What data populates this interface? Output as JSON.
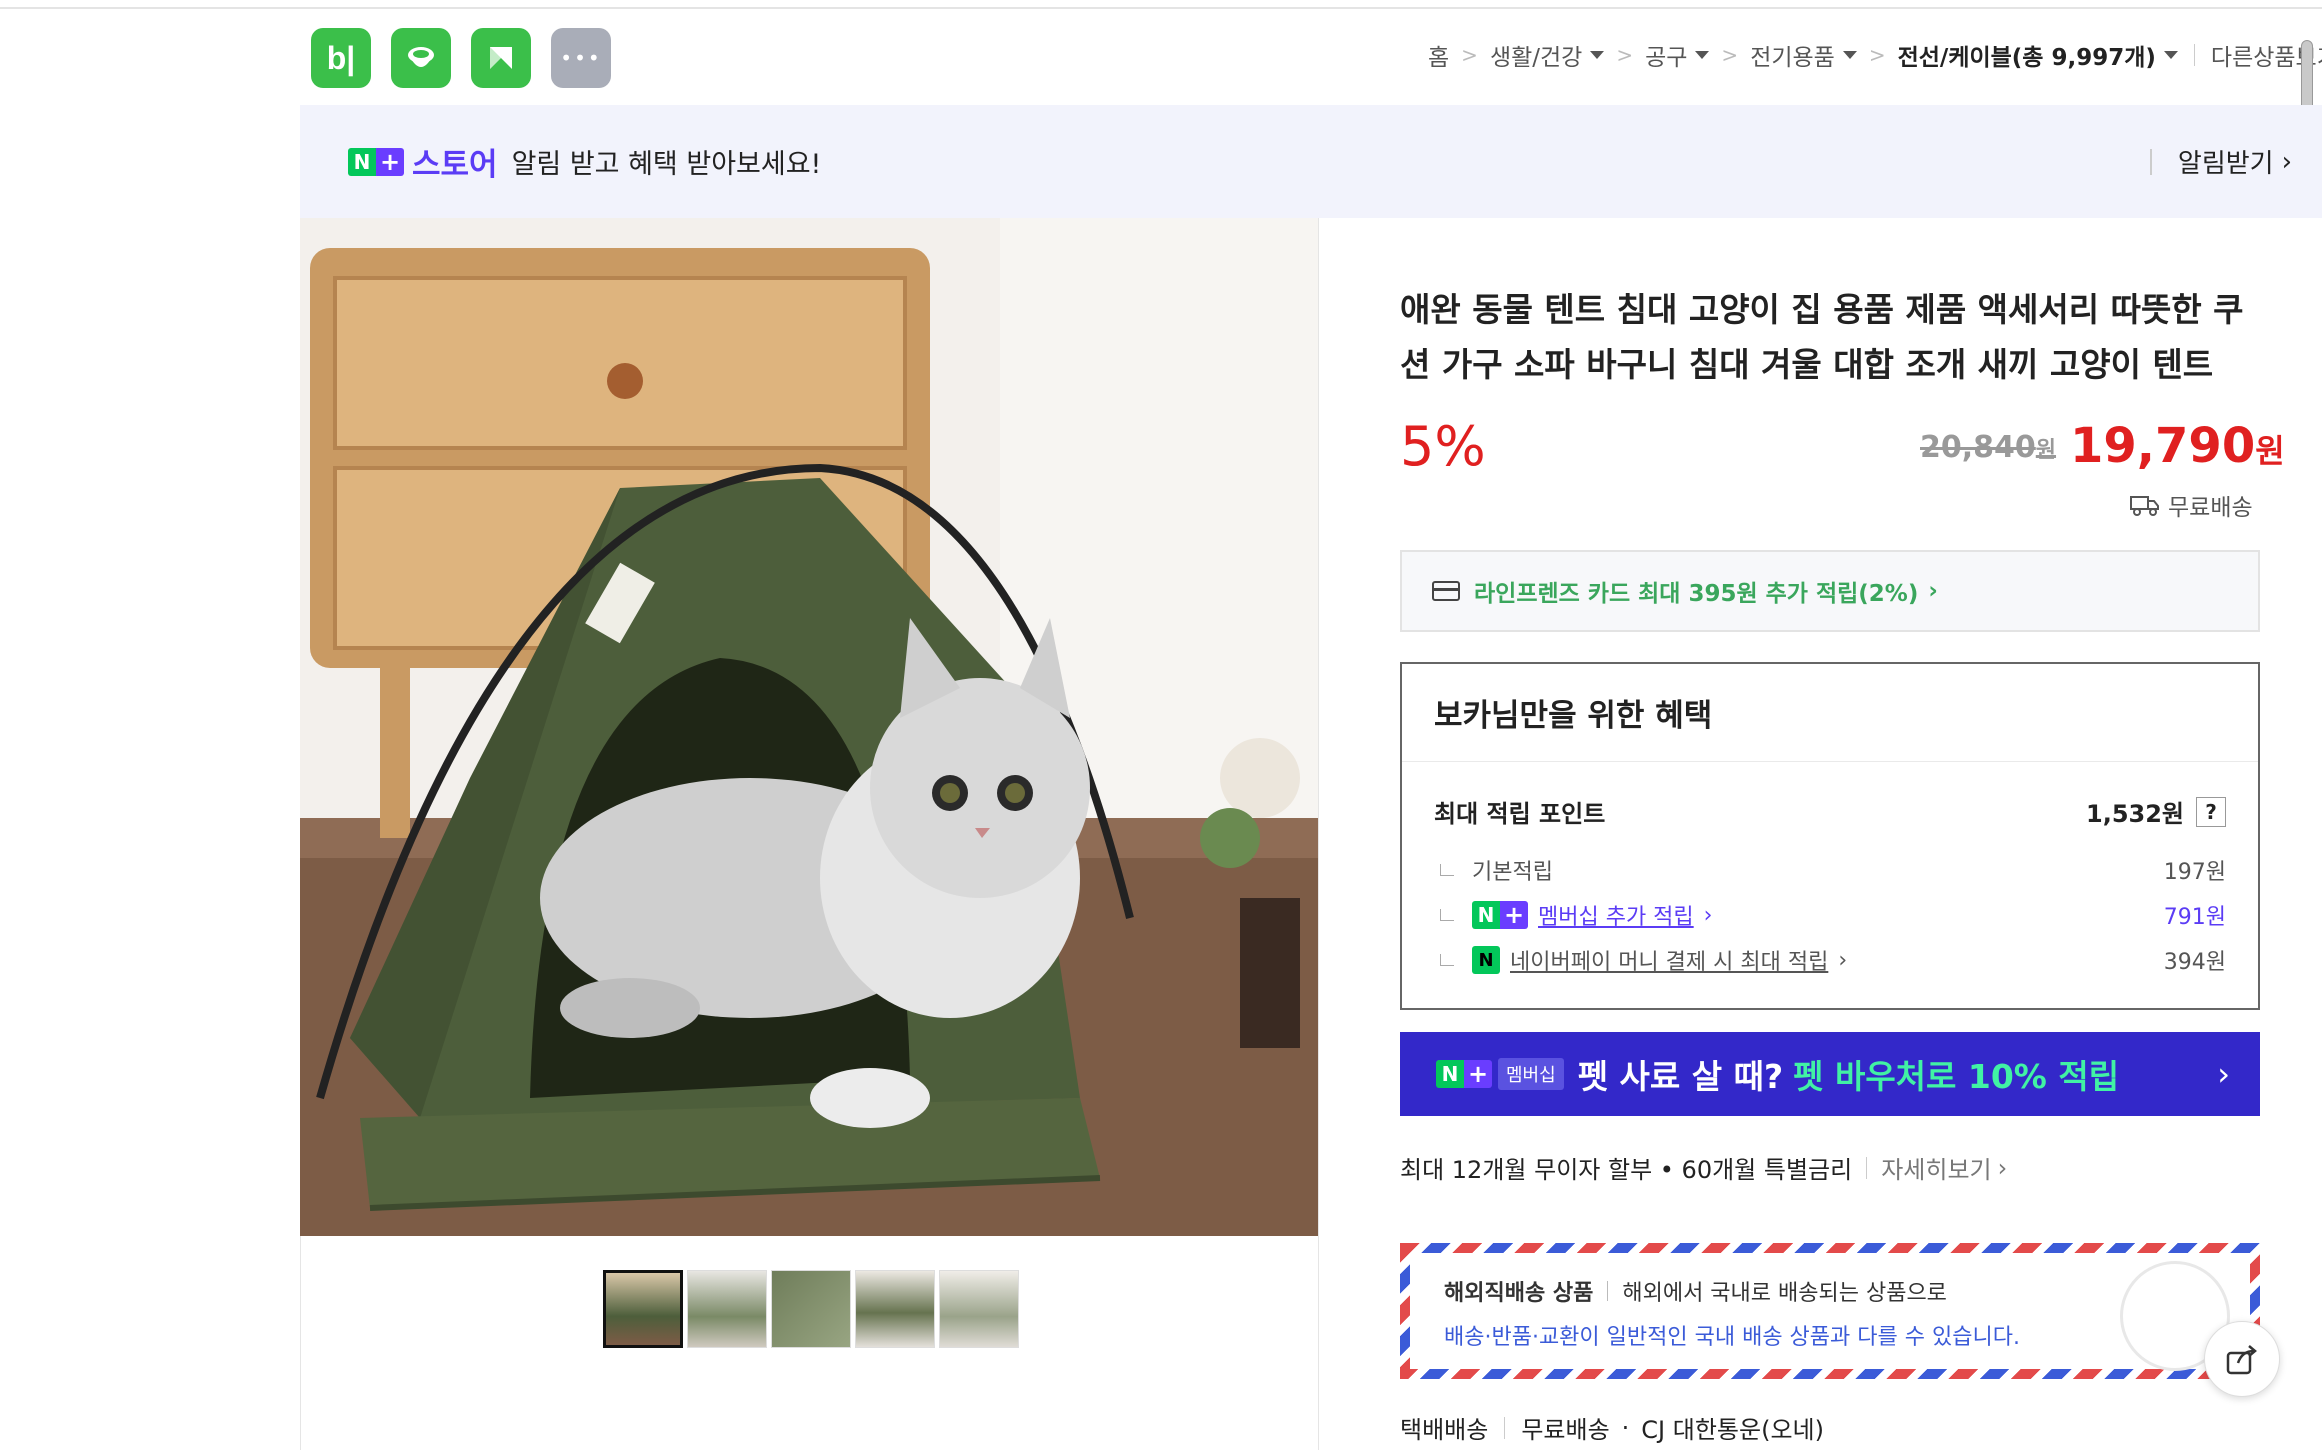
{
  "app_icons": [
    {
      "name": "blog-icon",
      "glyph": "b|"
    },
    {
      "name": "cafe-icon",
      "glyph": ""
    },
    {
      "name": "kakao-icon",
      "glyph": ""
    },
    {
      "name": "more-icon",
      "glyph": "•••"
    }
  ],
  "breadcrumb": {
    "home": "홈",
    "items": [
      "생활/건강",
      "공구",
      "전기용품"
    ],
    "current": "전선/케이블",
    "count": "(총 9,997개)",
    "other": "다른상품보기"
  },
  "banner": {
    "store": "스토어",
    "message": "알림 받고 혜택 받아보세요!",
    "action": "알림받기"
  },
  "product": {
    "title_line1": "애완 동물 텐트 침대 고양이 집 용품 제품 액세서리 따뜻한 쿠",
    "title_line2": "션 가구 소파 바구니 침대 겨울 대합 조개 새끼 고양이 텐트",
    "discount": "5%",
    "original_price": "20,840",
    "original_unit": "원",
    "sale_price": "19,790",
    "sale_unit": "원",
    "shipping": "무료배송"
  },
  "card_offer": "라인프렌즈 카드 최대 395원 추가 적립(2%)",
  "benefits": {
    "title": "보카님만을 위한 혜택",
    "max_points_label": "최대 적립 포인트",
    "max_points_value": "1,532원",
    "help": "?",
    "basic_label": "기본적립",
    "basic_value": "197원",
    "membership_label": "멤버십 추가 적립",
    "membership_value": "791원",
    "npay_label": "네이버페이 머니 결제 시 최대 적립",
    "npay_value": "394원"
  },
  "membership_banner": {
    "tag": "멤버십",
    "text1": "펫 사료 살 때?",
    "text2": "펫 바우처로 10% 적립"
  },
  "installment": {
    "text": "최대 12개월 무이자 할부 • 60개월 특별금리",
    "more": "자세히보기"
  },
  "overseas": {
    "title": "해외직배송 상품",
    "line1": "해외에서 국내로 배송되는 상품으로",
    "line2": "배송·반품·교환이 일반적인 국내 배송 상품과 다를 수 있습니다."
  },
  "delivery": {
    "type": "택배배송",
    "fee": "무료배송",
    "carrier": "CJ 대한통운(오네)"
  },
  "colors": {
    "accent_red": "#e02020",
    "naver_green": "#03c75a",
    "membership_purple": "#3328c9",
    "mint": "#41f2a4"
  }
}
